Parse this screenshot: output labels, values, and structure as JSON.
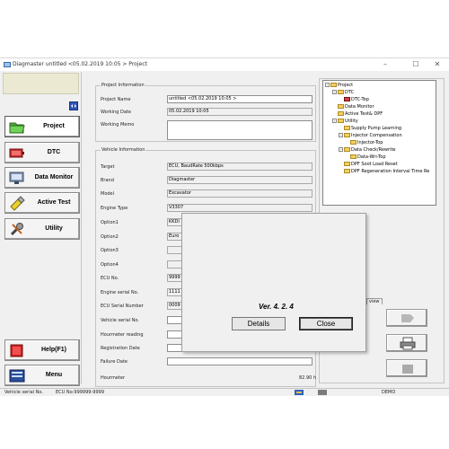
{
  "window": {
    "title": "Diagmaster untitled <05.02.2019 10:05 > Project",
    "controls": {
      "minimize": "–",
      "maximize": "☐",
      "close": "✕"
    }
  },
  "nav": {
    "items": [
      {
        "label": "Project",
        "icon": "folder-icon"
      },
      {
        "label": "DTC",
        "icon": "dtc-icon"
      },
      {
        "label": "Data Monitor",
        "icon": "monitor-icon"
      },
      {
        "label": "Active Test",
        "icon": "active-test-icon"
      },
      {
        "label": "Utility",
        "icon": "utility-icon"
      }
    ],
    "help_label": "Help(F1)",
    "menu_label": "Menu",
    "collapse_icon": "double-arrow-icon"
  },
  "project_info": {
    "title": "Project Information",
    "name_label": "Project Name",
    "name_value": "untitled <05.02.2019 10:05 >",
    "date_label": "Working Date",
    "date_value": "05.02.2019 10:05",
    "memo_label": "Working Memo",
    "memo_value": ""
  },
  "vehicle_info": {
    "title": "Vehicle Information",
    "target_label": "Target",
    "target_value": "ECU, BaudRate 500kbps",
    "brand_label": "Brand",
    "brand_value": "Diagmaster",
    "model_label": "Model",
    "model_value": "Excavator",
    "engine_type_label": "Engine Type",
    "engine_type_value": "V3307",
    "option1_label": "Option1",
    "option1_value": "KKDI",
    "option2_label": "Option2",
    "option2_value": "Euro",
    "option3_label": "Option3",
    "option3_value": "",
    "option4_label": "Option4",
    "option4_value": "",
    "ecu_no_label": "ECU No.",
    "ecu_no_value": "9999",
    "engine_serial_label": "Engine serial No.",
    "engine_serial_value": "1111",
    "ecu_serial_label": "ECU Serial Number",
    "ecu_serial_value": "0009",
    "vehicle_serial_label": "Vehicle serial No.",
    "vehicle_serial_value": "",
    "hourmeter_reading_label": "Hourmeter reading",
    "hourmeter_reading_value": "",
    "registration_label": "Registration Date",
    "registration_value": "",
    "failure_label": "Failure Date",
    "failure_value": "",
    "hourmeter_label": "Hourmeter",
    "hourmeter_value": "82.90 h"
  },
  "tree": {
    "items": [
      {
        "label": "Project",
        "level": 0,
        "expander": "-"
      },
      {
        "label": "DTC",
        "level": 1,
        "expander": "-"
      },
      {
        "label": "DTC-Top",
        "level": 2,
        "expander": ""
      },
      {
        "label": "Data Monitor",
        "level": 1,
        "expander": ""
      },
      {
        "label": "Active Test& DPF",
        "level": 1,
        "expander": ""
      },
      {
        "label": "Utility",
        "level": 1,
        "expander": "-"
      },
      {
        "label": "Supply Pump Learning",
        "level": 2,
        "expander": ""
      },
      {
        "label": "Injector Compensation",
        "level": 2,
        "expander": "-"
      },
      {
        "label": "Injector-Top",
        "level": 3,
        "expander": ""
      },
      {
        "label": "Data Check/Rewrite",
        "level": 2,
        "expander": "-"
      },
      {
        "label": "Data-Wri-Top",
        "level": 3,
        "expander": ""
      },
      {
        "label": "DPF Soot Load Reset",
        "level": 2,
        "expander": ""
      },
      {
        "label": "DPF Regeneration Interval Time Re",
        "level": 2,
        "expander": ""
      }
    ],
    "view_tab": "view"
  },
  "dialog": {
    "version": "Ver. 4. 2. 4",
    "details_label": "Details",
    "close_label": "Close"
  },
  "status": {
    "vehicle_serial": "Vehicle serial No.",
    "ecu": "ECU No:999999-9999",
    "mode": "DEMO"
  },
  "colors": {
    "window_bg": "#f0f0f0",
    "logo_bg": "#ebe9d2",
    "folder": "#f2d060",
    "help_icon": "#d02020"
  }
}
